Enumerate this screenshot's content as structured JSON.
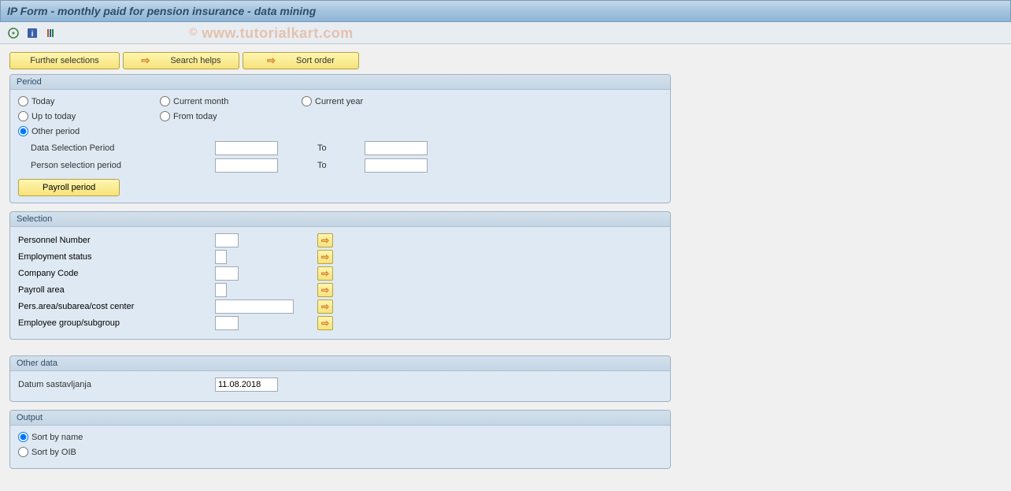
{
  "title": "IP Form - monthly paid for pension insurance - data mining",
  "watermark": "www.tutorialkart.com",
  "buttons": {
    "further_selections": "Further selections",
    "search_helps": "Search helps",
    "sort_order": "Sort order"
  },
  "period": {
    "title": "Period",
    "today": "Today",
    "current_month": "Current month",
    "current_year": "Current year",
    "up_to_today": "Up to today",
    "from_today": "From today",
    "other_period": "Other period",
    "data_selection_period": "Data Selection Period",
    "person_selection_period": "Person selection period",
    "to": "To",
    "payroll_period": "Payroll period"
  },
  "selection": {
    "title": "Selection",
    "personnel_number": "Personnel Number",
    "employment_status": "Employment status",
    "company_code": "Company Code",
    "payroll_area": "Payroll area",
    "pers_area": "Pers.area/subarea/cost center",
    "employee_group": "Employee group/subgroup"
  },
  "other_data": {
    "title": "Other data",
    "datum_label": "Datum sastavljanja",
    "datum_value": "11.08.2018"
  },
  "output": {
    "title": "Output",
    "sort_by_name": "Sort by name",
    "sort_by_oib": "Sort by OIB"
  }
}
